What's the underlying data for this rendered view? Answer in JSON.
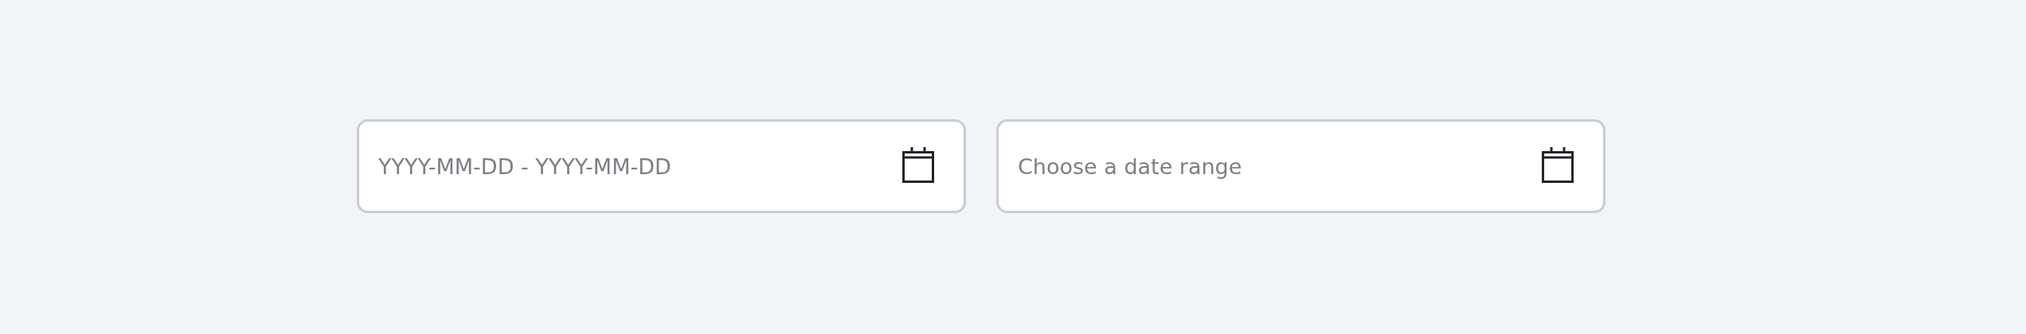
{
  "date_fields": [
    {
      "placeholder": "YYYY-MM-DD - YYYY-MM-DD"
    },
    {
      "placeholder": "Choose a date range"
    }
  ]
}
